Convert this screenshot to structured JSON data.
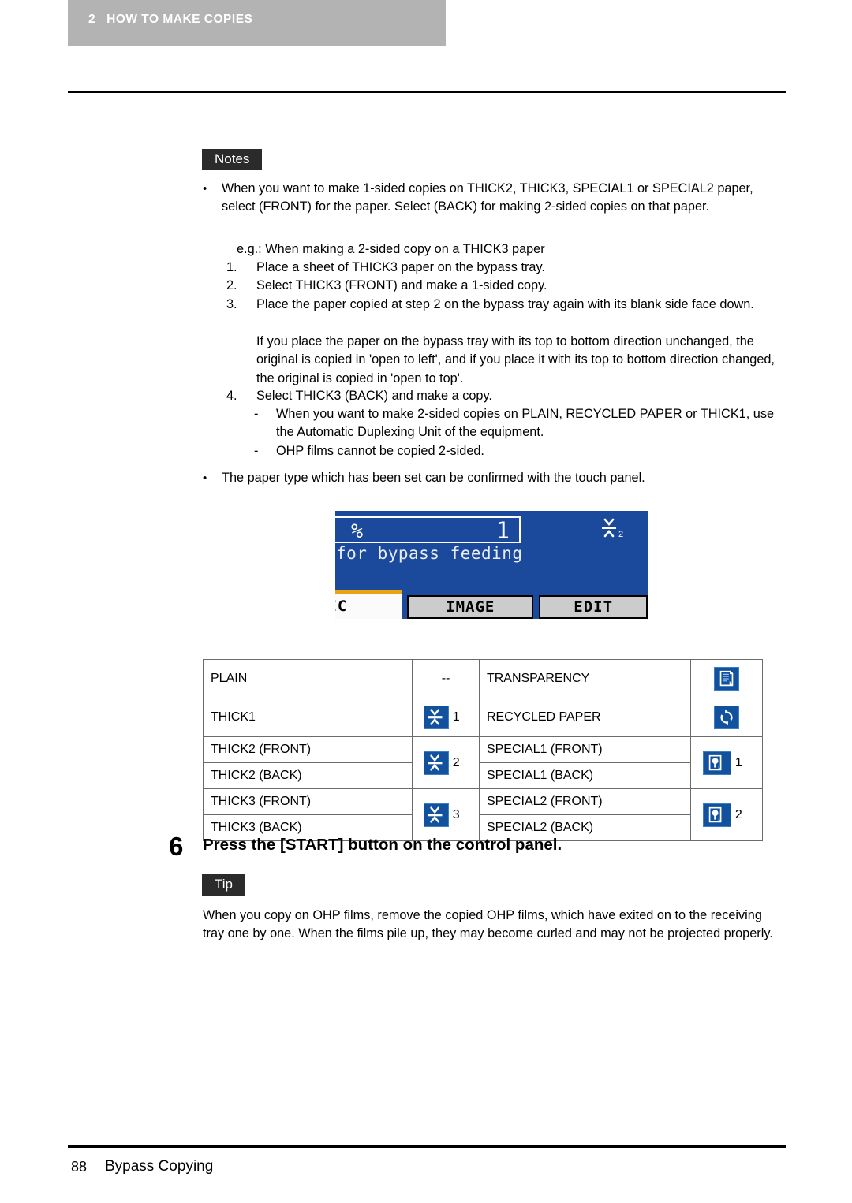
{
  "header": {
    "chapter_number": "2",
    "chapter_title": "HOW TO MAKE COPIES"
  },
  "notes": {
    "badge": "Notes",
    "bullet1": "When you want to make 1-sided copies on THICK2, THICK3, SPECIAL1 or SPECIAL2 paper, select (FRONT) for the paper. Select (BACK) for making 2-sided copies on that paper.",
    "eg_line": "e.g.: When making a 2-sided copy on a THICK3 paper",
    "steps": [
      {
        "num": "1.",
        "text": "Place a sheet of THICK3 paper on the bypass tray."
      },
      {
        "num": "2.",
        "text": "Select THICK3 (FRONT) and make a 1-sided copy."
      },
      {
        "num": "3.",
        "text": "Place the paper copied at step 2 on the bypass tray again with its blank side face down."
      },
      {
        "num": "",
        "text": "If you place the paper on the bypass tray with its top to bottom direction unchanged, the original is copied in 'open to left', and if you place it with its top to bottom direction changed, the original is copied in 'open to top'."
      },
      {
        "num": "4.",
        "text": "Select THICK3 (BACK) and make a copy."
      }
    ],
    "subdashes": [
      {
        "mark": "-",
        "text": "When you want to make 2-sided copies on PLAIN, RECYCLED PAPER or THICK1, use the Automatic Duplexing Unit of the equipment."
      },
      {
        "mark": "-",
        "text": "OHP films cannot be copied 2-sided."
      }
    ],
    "bullet2": "The paper type which has been set can be confirmed with the touch panel."
  },
  "lcd": {
    "percent": "%",
    "copy_count": "1",
    "message": "for bypass feeding",
    "paper_icon": "thick2-paper-icon",
    "tabs": [
      {
        "label": "SIC",
        "full": "BASIC",
        "active": true
      },
      {
        "label": "IMAGE",
        "full": "IMAGE",
        "active": false
      },
      {
        "label": "EDIT",
        "full": "EDIT",
        "active": false
      }
    ],
    "background_color": "#1b4a9c",
    "active_tab_accent": "#e8a317"
  },
  "paper_table": {
    "rows": [
      {
        "left": "PLAIN",
        "left_icon": "--",
        "right": "TRANSPARENCY",
        "right_icon": "transparency-icon"
      },
      {
        "left": "THICK1",
        "left_icon": "thick1-icon",
        "right": "RECYCLED PAPER",
        "right_icon": "recycled-paper-icon"
      },
      {
        "left": "THICK2 (FRONT)",
        "left_icon": "thick2-icon",
        "right": "SPECIAL1 (FRONT)",
        "right_icon": "special1-icon"
      },
      {
        "left": "THICK2 (BACK)",
        "left_icon": "",
        "right": "SPECIAL1 (BACK)",
        "right_icon": ""
      },
      {
        "left": "THICK3 (FRONT)",
        "left_icon": "thick3-icon",
        "right": "SPECIAL2 (FRONT)",
        "right_icon": "special2-icon"
      },
      {
        "left": "THICK3 (BACK)",
        "left_icon": "",
        "right": "SPECIAL2 (BACK)",
        "right_icon": ""
      }
    ],
    "icon_color": "#12519e"
  },
  "step6": {
    "number": "6",
    "title": "Press the [START] button on the control panel."
  },
  "tip": {
    "badge": "Tip",
    "text": "When you copy on OHP films, remove the copied OHP films, which have exited on to the receiving tray one by one. When the films pile up, they may become curled and may not be projected properly."
  },
  "footer": {
    "page_number": "88",
    "section": "Bypass Copying"
  }
}
